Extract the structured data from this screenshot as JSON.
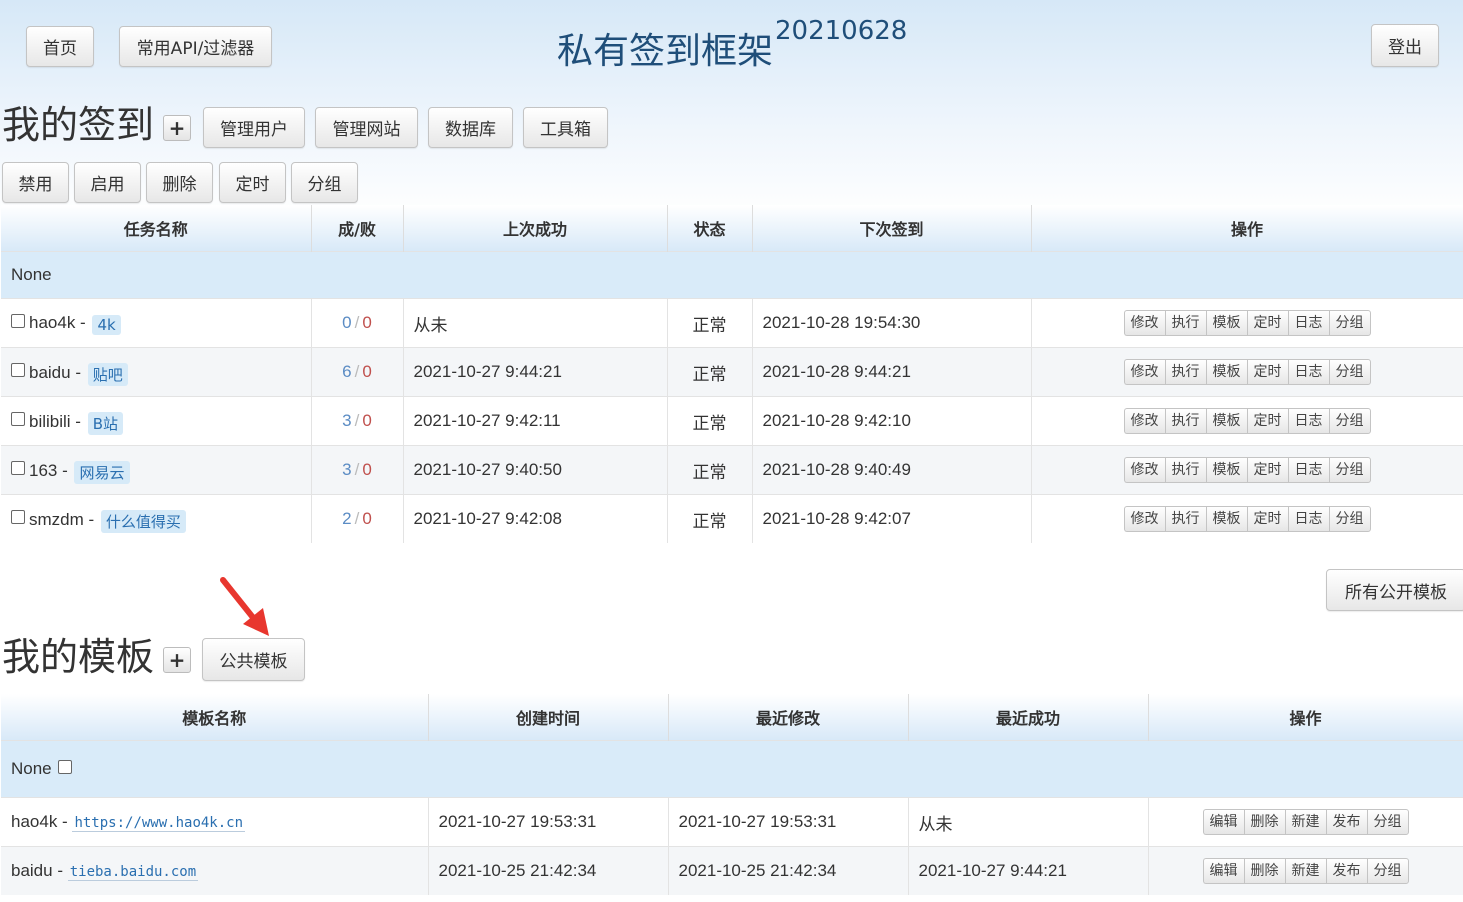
{
  "nav": {
    "home": "首页",
    "api_filters": "常用API/过滤器",
    "logout": "登出"
  },
  "title": {
    "main": "私有签到框架",
    "version": "20210628"
  },
  "tasks_section": {
    "heading": "我的签到",
    "add": "+",
    "buttons": [
      "管理用户",
      "管理网站",
      "数据库",
      "工具箱"
    ],
    "actions": [
      "禁用",
      "启用",
      "删除",
      "定时",
      "分组"
    ],
    "columns": [
      "任务名称",
      "成/败",
      "上次成功",
      "状态",
      "下次签到",
      "操作"
    ],
    "group": "None",
    "row_ops": [
      "修改",
      "执行",
      "模板",
      "定时",
      "日志",
      "分组"
    ],
    "rows": [
      {
        "name": "hao4k",
        "tag": "4k",
        "success": "0",
        "fail": "0",
        "last": "从未",
        "status": "正常",
        "next": "2021-10-28 19:54:30"
      },
      {
        "name": "baidu",
        "tag": "贴吧",
        "success": "6",
        "fail": "0",
        "last": "2021-10-27 9:44:21",
        "status": "正常",
        "next": "2021-10-28 9:44:21"
      },
      {
        "name": "bilibili",
        "tag": "B站",
        "success": "3",
        "fail": "0",
        "last": "2021-10-27 9:42:11",
        "status": "正常",
        "next": "2021-10-28 9:42:10"
      },
      {
        "name": "163",
        "tag": "网易云",
        "success": "3",
        "fail": "0",
        "last": "2021-10-27 9:40:50",
        "status": "正常",
        "next": "2021-10-28 9:40:49"
      },
      {
        "name": "smzdm",
        "tag": "什么值得买",
        "success": "2",
        "fail": "0",
        "last": "2021-10-27 9:42:08",
        "status": "正常",
        "next": "2021-10-28 9:42:07"
      }
    ]
  },
  "all_public_templates": "所有公开模板",
  "templates_section": {
    "heading": "我的模板",
    "add": "+",
    "public_button": "公共模板",
    "columns": [
      "模板名称",
      "创建时间",
      "最近修改",
      "最近成功",
      "操作"
    ],
    "group": "None",
    "row_ops": [
      "编辑",
      "删除",
      "新建",
      "发布",
      "分组"
    ],
    "rows": [
      {
        "name": "hao4k",
        "site": "https://www.hao4k.cn",
        "created": "2021-10-27 19:53:31",
        "modified": "2021-10-27 19:53:31",
        "last_success": "从未"
      },
      {
        "name": "baidu",
        "site": "tieba.baidu.com",
        "created": "2021-10-25 21:42:34",
        "modified": "2021-10-25 21:42:34",
        "last_success": "2021-10-27 9:44:21"
      }
    ]
  },
  "colors": {
    "title": "#1f4e79",
    "header_gradient": "#d8e9f8",
    "group_row": "#d9ebf9",
    "tag_bg": "#d6eaf8",
    "success_count": "#5b8cc4",
    "fail_count": "#c0504d",
    "annotation_arrow": "#e8362e"
  }
}
